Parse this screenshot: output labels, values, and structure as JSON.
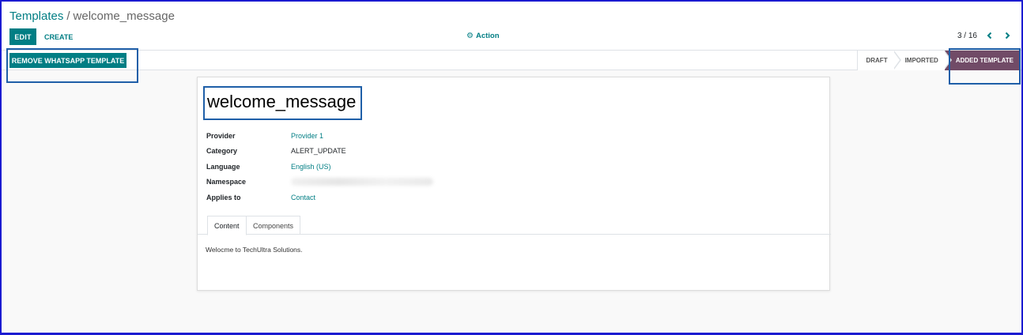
{
  "breadcrumb": {
    "parent": "Templates",
    "separator": "/",
    "current": "welcome_message"
  },
  "toolbar": {
    "edit_label": "EDIT",
    "create_label": "CREATE",
    "action_label": "Action",
    "action_icon": "gear-icon"
  },
  "pager": {
    "value": "3 / 16",
    "prev_icon": "chevron-left-icon",
    "next_icon": "chevron-right-icon"
  },
  "statusbar": {
    "remove_label": "REMOVE WHATSAPP TEMPLATE",
    "stages": [
      {
        "label": "DRAFT",
        "active": false
      },
      {
        "label": "IMPORTED",
        "active": false
      },
      {
        "label": "ADDED TEMPLATE",
        "active": true
      }
    ]
  },
  "record": {
    "title": "welcome_message",
    "fields": [
      {
        "label": "Provider",
        "value": "Provider 1",
        "link": true
      },
      {
        "label": "Category",
        "value": "ALERT_UPDATE",
        "link": false
      },
      {
        "label": "Language",
        "value": "English (US)",
        "link": true
      },
      {
        "label": "Namespace",
        "value": "",
        "link": false
      },
      {
        "label": "Applies to",
        "value": "Contact",
        "link": true
      }
    ],
    "tabs": [
      "Content",
      "Components"
    ],
    "content_text": "Welocme to TechUltra Solutions."
  },
  "colors": {
    "primary": "#017e84",
    "active_stage": "#714b67",
    "highlight": "#1f5fa8"
  }
}
